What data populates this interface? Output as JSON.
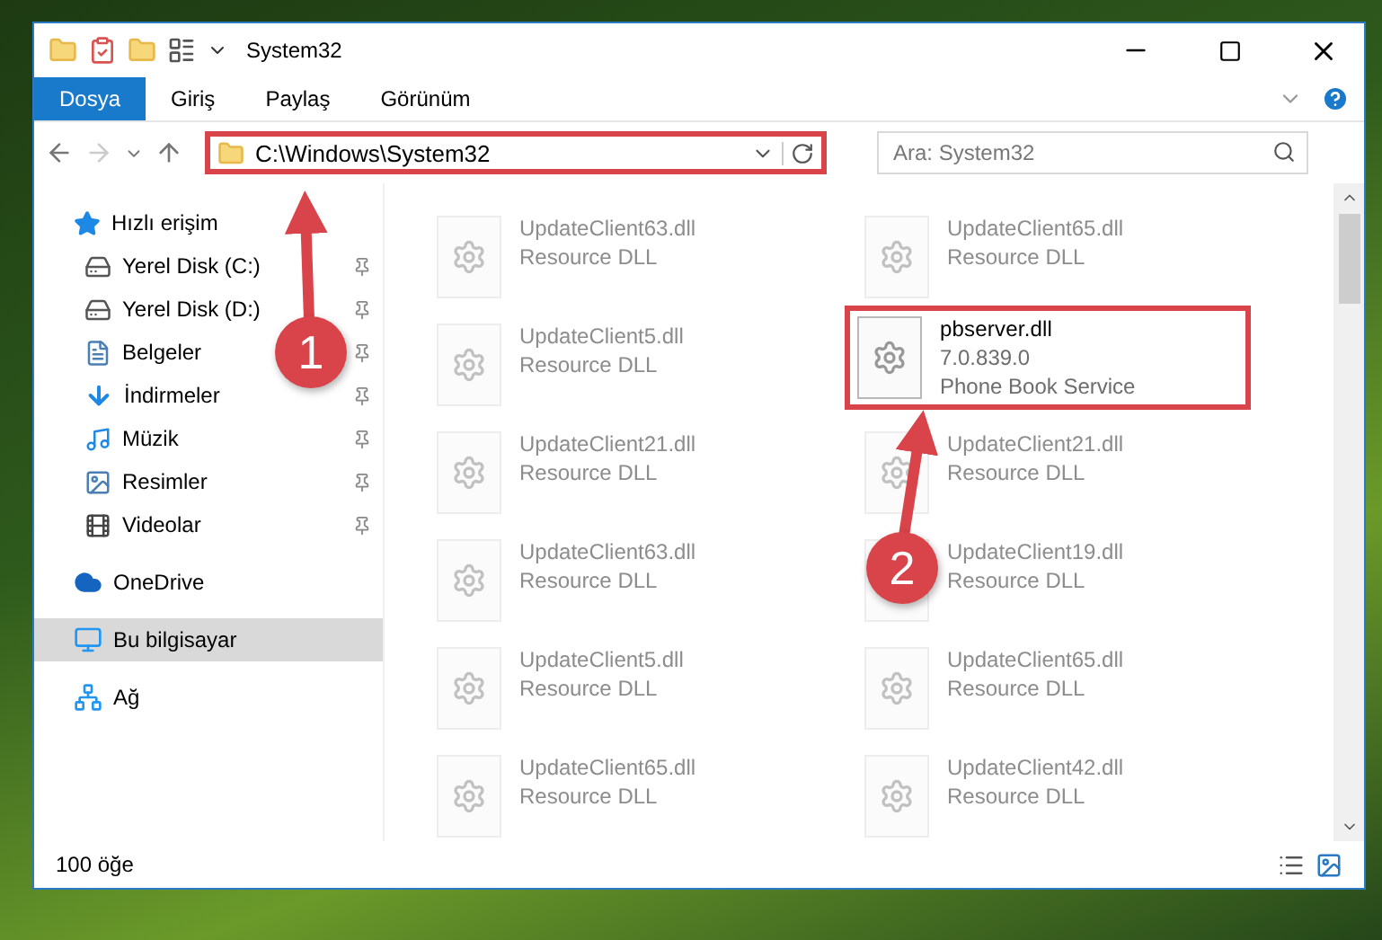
{
  "window": {
    "title": "System32"
  },
  "ribbon_tabs": [
    {
      "label": "Dosya",
      "selected": true
    },
    {
      "label": "Giriş",
      "selected": false
    },
    {
      "label": "Paylaş",
      "selected": false
    },
    {
      "label": "Görünüm",
      "selected": false
    }
  ],
  "address_bar": {
    "path": "C:\\Windows\\System32",
    "highlighted": true
  },
  "search": {
    "placeholder": "Ara: System32"
  },
  "sidebar": [
    {
      "label": "Hızlı erişim",
      "selected": false,
      "children": [
        {
          "label": "Yerel Disk (C:)",
          "pinned": true
        },
        {
          "label": "Yerel Disk (D:)",
          "pinned": true
        },
        {
          "label": "Belgeler",
          "pinned": true
        },
        {
          "label": "İndirmeler",
          "pinned": true
        },
        {
          "label": "Müzik",
          "pinned": true
        },
        {
          "label": "Resimler",
          "pinned": true
        },
        {
          "label": "Videolar",
          "pinned": true
        }
      ]
    },
    {
      "label": "OneDrive",
      "selected": false
    },
    {
      "label": "Bu bilgisayar",
      "selected": true
    },
    {
      "label": "Ağ",
      "selected": false
    }
  ],
  "files": [
    {
      "name": "UpdateClient63.dll",
      "lines": [
        "Resource DLL"
      ],
      "faded": true,
      "highlighted": false
    },
    {
      "name": "UpdateClient65.dll",
      "lines": [
        "Resource DLL"
      ],
      "faded": true,
      "highlighted": false
    },
    {
      "name": "UpdateClient5.dll",
      "lines": [
        "Resource DLL"
      ],
      "faded": true,
      "highlighted": false
    },
    {
      "name": "pbserver.dll",
      "lines": [
        "7.0.839.0",
        "Phone Book Service"
      ],
      "faded": false,
      "highlighted": true
    },
    {
      "name": "UpdateClient21.dll",
      "lines": [
        "Resource DLL"
      ],
      "faded": true,
      "highlighted": false
    },
    {
      "name": "UpdateClient21.dll",
      "lines": [
        "Resource DLL"
      ],
      "faded": true,
      "highlighted": false
    },
    {
      "name": "UpdateClient63.dll",
      "lines": [
        "Resource DLL"
      ],
      "faded": true,
      "highlighted": false
    },
    {
      "name": "UpdateClient19.dll",
      "lines": [
        "Resource DLL"
      ],
      "faded": true,
      "highlighted": false
    },
    {
      "name": "UpdateClient5.dll",
      "lines": [
        "Resource DLL"
      ],
      "faded": true,
      "highlighted": false
    },
    {
      "name": "UpdateClient65.dll",
      "lines": [
        "Resource DLL"
      ],
      "faded": true,
      "highlighted": false
    },
    {
      "name": "UpdateClient65.dll",
      "lines": [
        "Resource DLL"
      ],
      "faded": true,
      "highlighted": false
    },
    {
      "name": "UpdateClient42.dll",
      "lines": [
        "Resource DLL"
      ],
      "faded": true,
      "highlighted": false
    }
  ],
  "status_bar": {
    "item_count": "100 öğe"
  },
  "annotations": [
    {
      "number": "1"
    },
    {
      "number": "2"
    }
  ]
}
